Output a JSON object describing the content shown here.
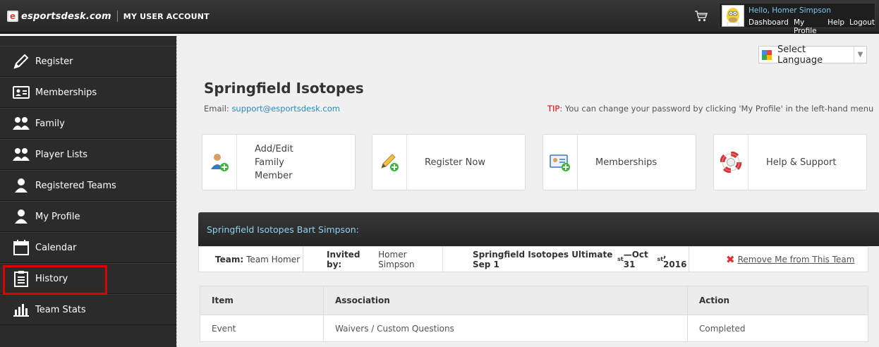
{
  "header": {
    "logo_text": "esportsdesk.com",
    "logo_subtitle": "MY USER ACCOUNT",
    "greeting": "Hello, Homer Simpson",
    "nav": [
      "Dashboard",
      "My Profile",
      "Help",
      "Logout"
    ]
  },
  "sidebar": {
    "items": [
      {
        "label": "Register",
        "icon": "pencil-icon"
      },
      {
        "label": "Memberships",
        "icon": "id-card-icon"
      },
      {
        "label": "Family",
        "icon": "people-icon"
      },
      {
        "label": "Player Lists",
        "icon": "people-icon"
      },
      {
        "label": "Registered Teams",
        "icon": "person-icon"
      },
      {
        "label": "My Profile",
        "icon": "person-icon"
      },
      {
        "label": "Calendar",
        "icon": "calendar-icon"
      },
      {
        "label": "History",
        "icon": "clipboard-icon"
      },
      {
        "label": "Team Stats",
        "icon": "bar-chart-icon"
      }
    ],
    "highlighted": "History"
  },
  "translate": {
    "label": "Select Language"
  },
  "page": {
    "title": "Springfield Isotopes",
    "email_label": "Email:",
    "email": "support@esportsdesk.com",
    "tip_label": "TIP",
    "tip_text": ": You can change your password by clicking 'My Profile' in the left-hand menu"
  },
  "cards": [
    {
      "label": "Add/Edit Family Member",
      "icon": "add-family-member-icon"
    },
    {
      "label": "Register Now",
      "icon": "pencil-add-icon"
    },
    {
      "label": "Memberships",
      "icon": "membership-card-icon"
    },
    {
      "label": "Help & Support",
      "icon": "lifebuoy-icon"
    }
  ],
  "team": {
    "heading": "Springfield Isotopes Bart Simpson:",
    "team_label": "Team:",
    "team_value": "Team Homer",
    "invited_label": "Invited by:",
    "invited_value": "Homer Simpson",
    "season_prefix": "Springfield Isotopes Ultimate Sep 1",
    "season_sup1": "st",
    "season_mid": " —Oct 31",
    "season_sup2": "st",
    "season_suffix": ", 2016",
    "remove_label": "Remove Me from This Team"
  },
  "table": {
    "headers": [
      "Item",
      "Association",
      "Action"
    ],
    "rows": [
      [
        "Event",
        "Waivers / Custom Questions",
        "Completed"
      ]
    ]
  },
  "colors": {
    "accent": "#2a8cb8",
    "highlight": "#e00000",
    "sidebar": "#2b2b2b"
  }
}
